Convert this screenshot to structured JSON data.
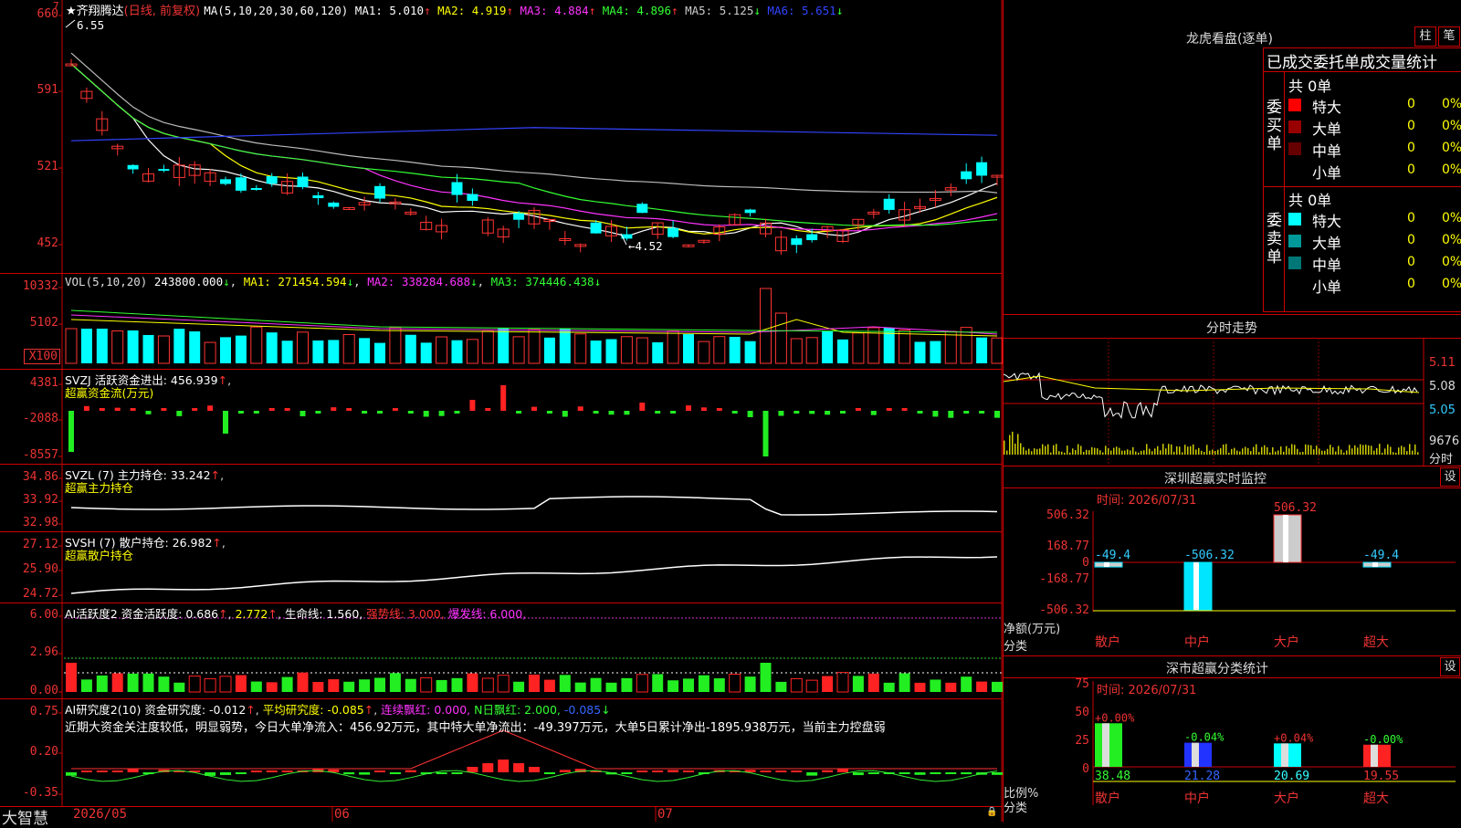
{
  "app": {
    "logo": "大智慧",
    "badge": "7"
  },
  "stock": {
    "name": "★齐翔腾达",
    "mode": "(日线, 前复权)"
  },
  "ma": {
    "label": "MA(5,10,20,30,60,120)",
    "items": [
      {
        "name": "MA1:",
        "value": "5.010",
        "arrow": "↑",
        "color": "#ffffff"
      },
      {
        "name": "MA2:",
        "value": "4.919",
        "arrow": "↑",
        "color": "#ffff00"
      },
      {
        "name": "MA3:",
        "value": "4.884",
        "arrow": "↑",
        "color": "#ff33ff"
      },
      {
        "name": "MA4:",
        "value": "4.896",
        "arrow": "↑",
        "color": "#33ff33"
      },
      {
        "name": "MA5:",
        "value": "5.125",
        "arrow": "↓",
        "color": "#cccccc"
      },
      {
        "name": "MA6:",
        "value": "5.651",
        "arrow": "↓",
        "color": "#3344ff"
      }
    ]
  },
  "price_axis": [
    "660",
    "591",
    "521",
    "452"
  ],
  "price_marks": {
    "high": "6.55",
    "low": "4.52"
  },
  "vol": {
    "label": "VOL(5,10,20)",
    "value": "243800.000",
    "ma1": "MA1: 271454.594",
    "ma2": "MA2: 338284.688",
    "ma3": "MA3: 374446.438",
    "axis": [
      "10332",
      "5102",
      "X100"
    ]
  },
  "svzj": {
    "label": "SVZJ  活跃资金进出: 456.939",
    "sub": "超赢资金流(万元)",
    "axis": [
      "4381",
      "-2088",
      "-8557"
    ]
  },
  "svzl": {
    "label": "SVZL (7) 主力持仓: 33.242",
    "sub": "超赢主力持仓",
    "axis": [
      "34.86",
      "33.92",
      "32.98"
    ]
  },
  "svsh": {
    "label": "SVSH (7) 散户持仓: 26.982",
    "sub": "超赢散户持仓",
    "axis": [
      "27.12",
      "25.90",
      "24.72"
    ]
  },
  "ai1": {
    "label": "AI活跃度2 资金活跃度: 0.686",
    "v2": "2.772",
    "v3": "生命线: 1.560,",
    "v4": "强势线: 3.000,",
    "v5": "爆发线: 6.000,",
    "axis": [
      "6.00",
      "2.96",
      "0.00"
    ]
  },
  "ai2": {
    "label": "AI研究度2(10) 资金研究度: -0.012",
    "v2": "平均研究度: -0.085",
    "v3": "连续飘红: 0.000,",
    "v4": "N日飘红: 2.000,",
    "v5": "-0.085",
    "note": "近期大资金关注度较低，明显弱势，今日大单净流入：456.92万元，其中特大单净流出：-49.397万元，大单5日累计净出-1895.938万元，当前主力控盘弱",
    "axis": [
      "0.75",
      "0.20",
      "-0.35"
    ]
  },
  "date_axis": [
    "2026/05",
    "06",
    "07"
  ],
  "lhb": {
    "title": "龙虎看盘(逐单)",
    "btn1": "柱",
    "btn2": "笔",
    "header": "已成交委托单成交量统计",
    "buy": {
      "side": "委买单",
      "total": "共 0单",
      "rows": [
        {
          "label": "特大",
          "count": "0",
          "pct": "0%",
          "color": "#ff0000"
        },
        {
          "label": "大单",
          "count": "0",
          "pct": "0%",
          "color": "#990000"
        },
        {
          "label": "中单",
          "count": "0",
          "pct": "0%",
          "color": "#660000"
        },
        {
          "label": "小单",
          "count": "0",
          "pct": "0%",
          "color": ""
        }
      ]
    },
    "sell": {
      "side": "委卖单",
      "total": "共 0单",
      "rows": [
        {
          "label": "特大",
          "count": "0",
          "pct": "0%",
          "color": "#00ffff"
        },
        {
          "label": "大单",
          "count": "0",
          "pct": "0%",
          "color": "#009999"
        },
        {
          "label": "中单",
          "count": "0",
          "pct": "0%",
          "color": "#007777"
        },
        {
          "label": "小单",
          "count": "0",
          "pct": "0%",
          "color": ""
        }
      ]
    }
  },
  "intraday": {
    "title": "分时走势",
    "axis": [
      "5.11",
      "5.08",
      "5.05"
    ],
    "vol": "9676",
    "vol_unit": "分时"
  },
  "monitor": {
    "title": "深圳超赢实时监控",
    "btn": "设",
    "time": "时间: 2026/07/31",
    "axis": [
      "506.32",
      "168.77",
      "0",
      "-168.77",
      "-506.32"
    ],
    "ylabel": "净额(万元)",
    "xlabel": "分类",
    "cats": [
      "散户",
      "中户",
      "大户",
      "超大"
    ],
    "values": [
      "-49.4",
      "-506.32",
      "506.32",
      "-49.4"
    ]
  },
  "classify": {
    "title": "深市超赢分类统计",
    "btn": "设",
    "time": "时间: 2026/07/31",
    "axis": [
      "75",
      "50",
      "25",
      "0"
    ],
    "ylabel": "比例%",
    "xlabel": "分类",
    "cats": [
      "散户",
      "中户",
      "大户",
      "超大"
    ],
    "pcts": [
      "+0.00%",
      "-0.04%",
      "+0.04%",
      "-0.00%"
    ],
    "vals": [
      "38.48",
      "21.28",
      "20.69",
      "19.55"
    ]
  }
}
